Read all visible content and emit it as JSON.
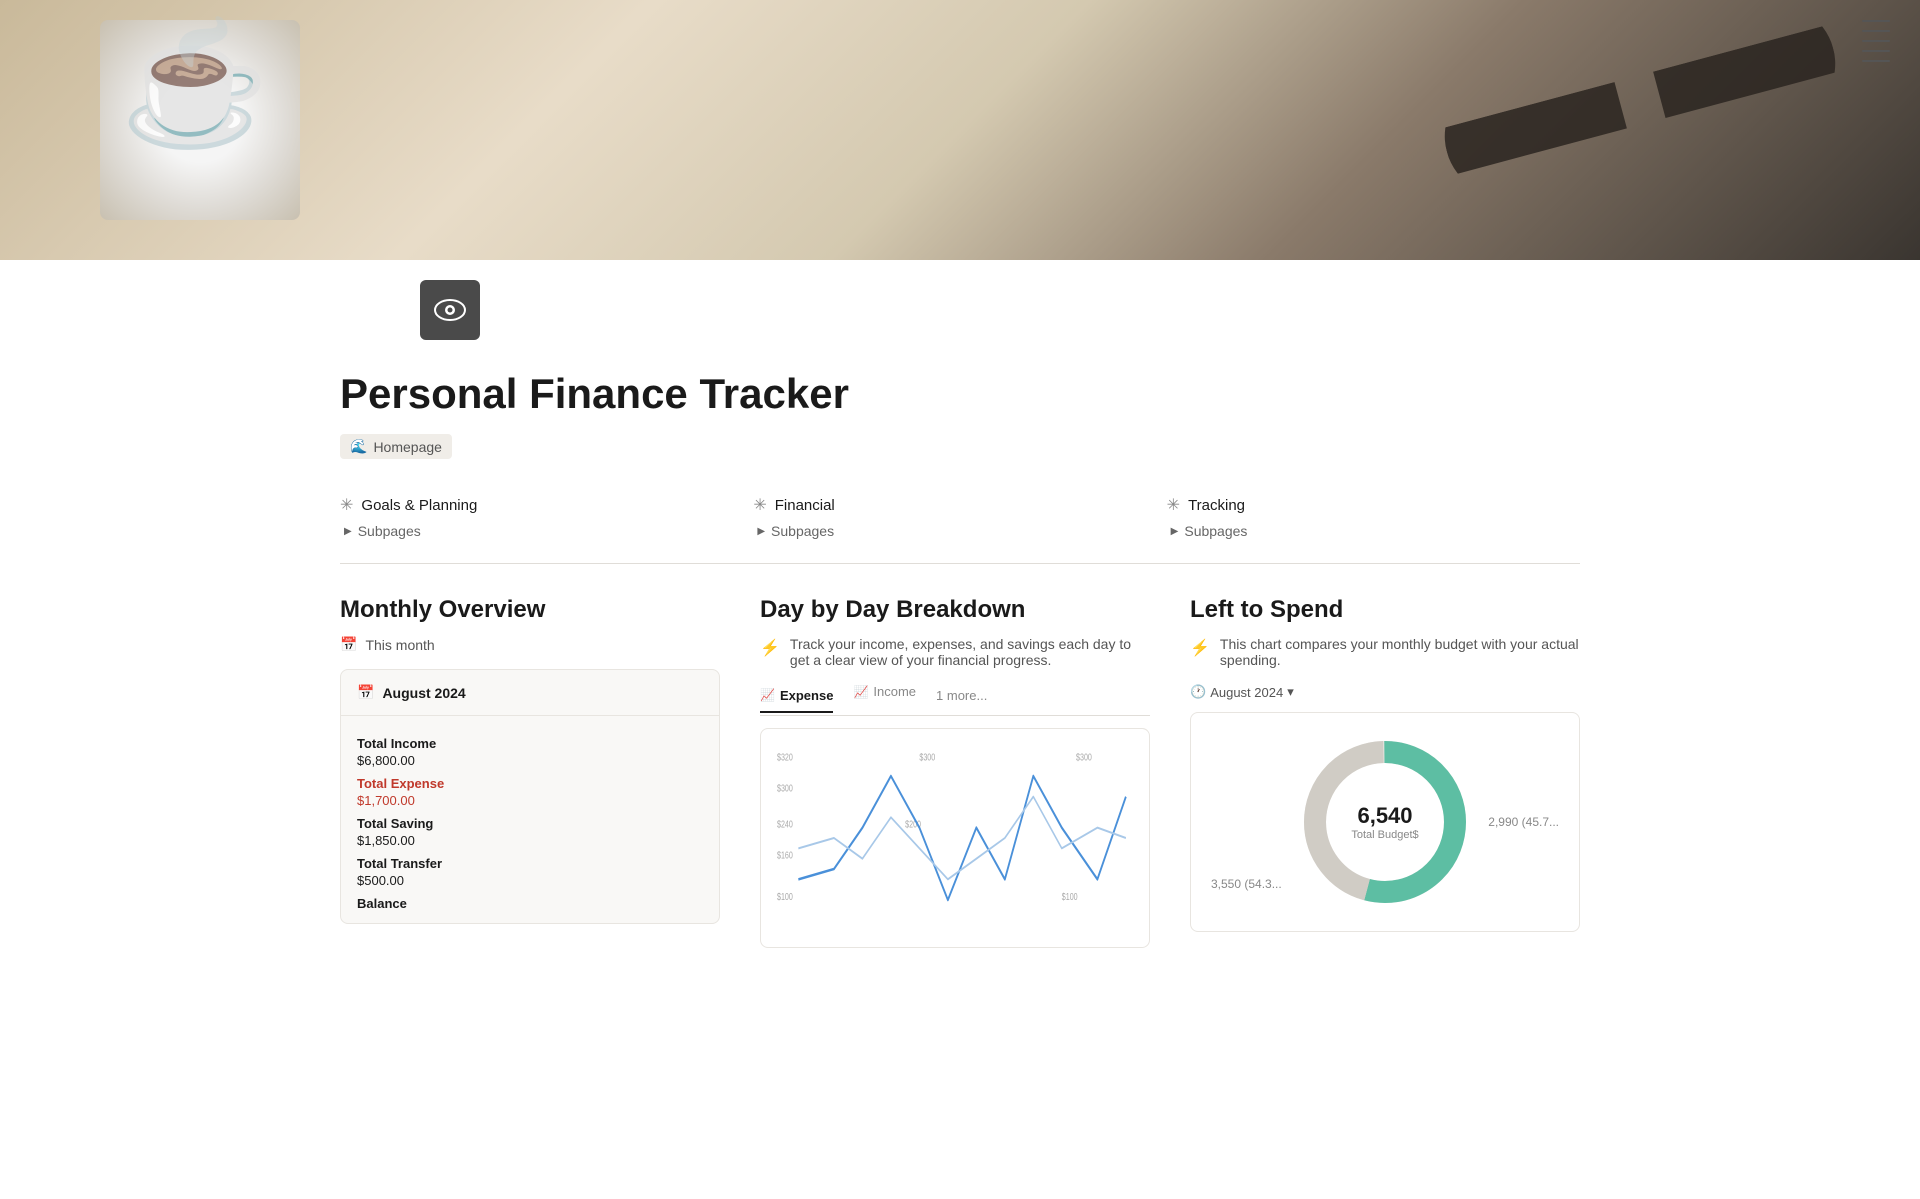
{
  "hero": {
    "alt": "Personal Finance Tracker hero image"
  },
  "page": {
    "icon": "👁",
    "title": "Personal Finance Tracker",
    "homepage_badge": "Homepage"
  },
  "nav": {
    "sections": [
      {
        "id": "goals",
        "icon": "✳",
        "title": "Goals & Planning",
        "subpages_label": "Subpages"
      },
      {
        "id": "financial",
        "icon": "✳",
        "title": "Financial",
        "subpages_label": "Subpages"
      },
      {
        "id": "tracking",
        "icon": "✳",
        "title": "Tracking",
        "subpages_label": "Subpages"
      }
    ]
  },
  "monthly_overview": {
    "section_title": "Monthly Overview",
    "this_month_label": "This month",
    "card": {
      "header": "August 2024",
      "metrics": [
        {
          "label": "Total Income",
          "value": "$6,800.00",
          "type": "normal"
        },
        {
          "label": "Total Expense",
          "value": "$1,700.00",
          "type": "expense"
        },
        {
          "label": "Total Saving",
          "value": "$1,850.00",
          "type": "normal"
        },
        {
          "label": "Total Transfer",
          "value": "$500.00",
          "type": "normal"
        },
        {
          "label": "Balance",
          "value": "",
          "type": "normal"
        }
      ]
    }
  },
  "day_breakdown": {
    "section_title": "Day by Day Breakdown",
    "description": "Track your income, expenses, and savings each day to get a clear view of your financial progress.",
    "tabs": [
      {
        "label": "Expense",
        "icon": "📈",
        "active": true
      },
      {
        "label": "Income",
        "icon": "📈",
        "active": false
      }
    ],
    "more_label": "1 more...",
    "chart": {
      "y_labels": [
        "$320",
        "$300",
        "$300",
        "$300"
      ],
      "x_labels": [
        "$240",
        "$200",
        "$160",
        "$100",
        "$100"
      ]
    }
  },
  "left_to_spend": {
    "section_title": "Left to Spend",
    "description": "This chart compares your monthly budget with your actual spending.",
    "period": "August 2024",
    "donut": {
      "center_value": "6,540",
      "center_label": "Total Budget$",
      "legend_left_value": "3,550 (54.3...",
      "legend_right_value": "2,990 (45.7..."
    }
  },
  "menu_lines": 5
}
